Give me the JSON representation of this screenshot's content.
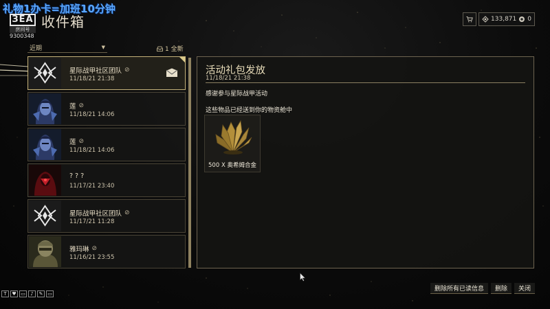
{
  "overlay": {
    "banner": "礼物1办卡=加班10分钟",
    "logo_text": "ЗЕА",
    "logo_sub": "房间号",
    "room_id": "9300348"
  },
  "header": {
    "title": "收件箱"
  },
  "currency": {
    "cart_icon": "cart-icon",
    "credits_icon": "credits-icon",
    "credits": "133,871",
    "platinum_icon": "platinum-icon",
    "platinum": "0"
  },
  "filter": {
    "selected": "近期",
    "new_count": "1 全新"
  },
  "messages": [
    {
      "sender": "星际战甲社区团队",
      "date": "11/18/21 21:38",
      "avatar": "lotus-logo",
      "selected": true,
      "has_mail_icon": true
    },
    {
      "sender": "莲",
      "date": "11/18/21 14:06",
      "avatar": "lotus-portrait"
    },
    {
      "sender": "莲",
      "date": "11/18/21 14:06",
      "avatar": "lotus-portrait"
    },
    {
      "sender": "? ? ?",
      "date": "11/17/21 23:40",
      "avatar": "red-figure"
    },
    {
      "sender": "星际战甲社区团队",
      "date": "11/17/21 11:28",
      "avatar": "lotus-logo"
    },
    {
      "sender": "雅玛琳",
      "date": "11/16/21 23:55",
      "avatar": "helmet-figure"
    }
  ],
  "detail": {
    "title": "活动礼包发放",
    "date": "11/18/21 21:38",
    "body_line1": "感谢参与星际战甲活动",
    "body_line2": "这些物品已经送到你的物资舱中",
    "reward_label": "500 X 奥希姆合金"
  },
  "actions": {
    "delete_all_read": "删除所有已读信息",
    "delete": "删除",
    "close": "关闭"
  },
  "tools": [
    "T",
    "♥",
    "▭",
    "♪",
    "✎",
    "▭"
  ],
  "colors": {
    "accent_gold": "#c5b27a",
    "banner_blue": "#5aa8ff",
    "panel_border": "#6e6450"
  }
}
